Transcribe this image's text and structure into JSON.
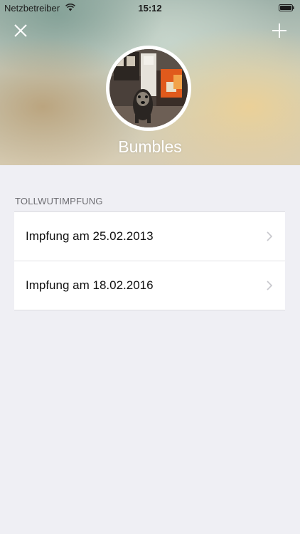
{
  "status_bar": {
    "carrier": "Netzbetreiber",
    "time": "15:12",
    "icons": [
      "wifi-icon",
      "battery-icon"
    ]
  },
  "header": {
    "close_icon": "close-icon",
    "add_icon": "plus-icon",
    "pet_name": "Bumbles",
    "avatar": "dog-photo"
  },
  "section": {
    "title": "TOLLWUTIMPFUNG",
    "items": [
      {
        "label": "Impfung am 25.02.2013",
        "icon": "chevron-right-icon"
      },
      {
        "label": "Impfung am 18.02.2016",
        "icon": "chevron-right-icon"
      }
    ]
  },
  "colors": {
    "background": "#efeff4",
    "cell": "#ffffff",
    "section_header_text": "#6d6d72",
    "chevron": "#c7c7cc"
  }
}
